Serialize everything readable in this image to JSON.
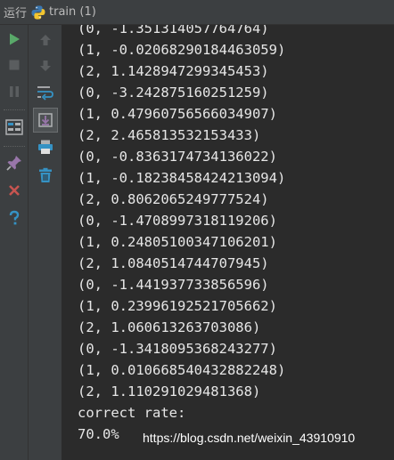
{
  "titlebar": {
    "run_label": "运行",
    "tab_title": "train (1)",
    "tab_icon": "python-icon"
  },
  "toolbar_left": [
    {
      "name": "run-icon",
      "color": "#59a869"
    },
    {
      "name": "stop-icon",
      "color": "#5a5d5f"
    },
    {
      "name": "pause-icon",
      "color": "#5a5d5f"
    },
    {
      "name": "layout-icon",
      "color": "#afb1b3"
    },
    {
      "name": "pin-icon",
      "color": "#9876aa"
    },
    {
      "name": "close-icon",
      "color": "#c75450"
    },
    {
      "name": "help-icon",
      "color": "#3592c4"
    }
  ],
  "toolbar_right": [
    {
      "name": "up-arrow-icon",
      "color": "#5a5d5f"
    },
    {
      "name": "down-arrow-icon",
      "color": "#5a5d5f"
    },
    {
      "name": "soft-wrap-icon",
      "color": "#3592c4"
    },
    {
      "name": "scroll-to-end-icon",
      "color": "#afb1b3"
    },
    {
      "name": "print-icon",
      "color": "#3592c4"
    },
    {
      "name": "trash-icon",
      "color": "#3592c4"
    }
  ],
  "console": {
    "lines": [
      "(0, -1.351314057764764)",
      "(1, -0.02068290184463059)",
      "(2, 1.142894729934545З)",
      "(0, -3.24287516025125‍9)",
      "(1, 0.4796075656603490‌7)",
      "(2, 2.465813532153433)",
      "(0, -0.8363174734136022)",
      "(1, -0.18238458424213094)",
      "(2, 0.8062065249777524)",
      "(0, -1.4708997318119206)",
      "(1, 0.24805100347106201)",
      "(2, 1.0840514744707945)",
      "(0, -1.441937733856596)",
      "(1, 0.23996192521705662)",
      "(2, 1.060613263703086)",
      "(0, -1.3418095368243277)",
      "(1, 0.010668540432882248)",
      "(2, 1.110291029481368)",
      "correct rate:",
      "70.0%"
    ],
    "text_color": "#e6e6e6",
    "background": "#2b2b2b"
  },
  "watermark": "https://blog.csdn.net/weixin_43910910"
}
